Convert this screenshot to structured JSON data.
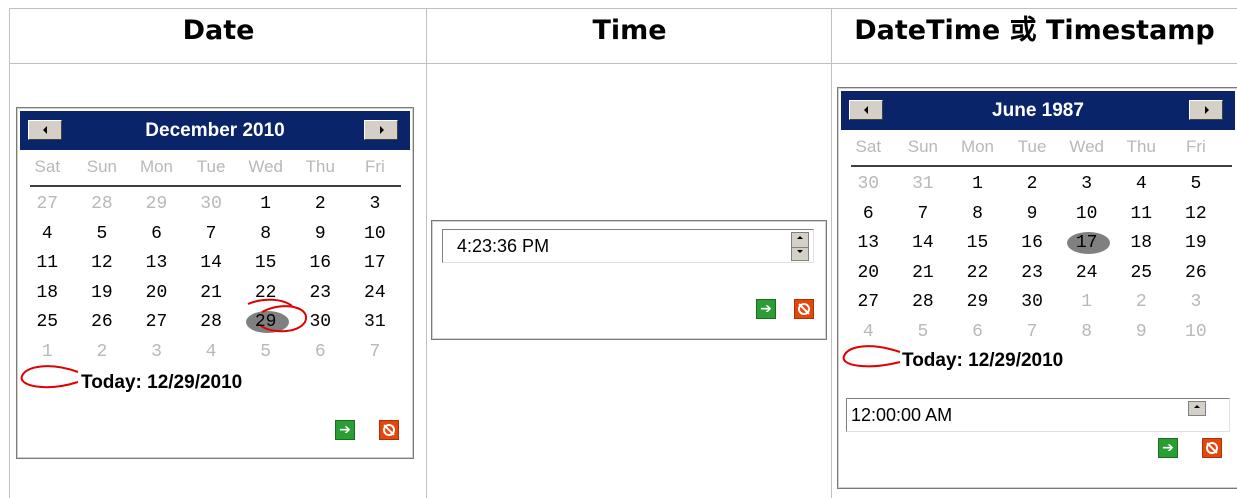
{
  "headers": {
    "date": "Date",
    "time": "Time",
    "datetime": "DateTime 或 Timestamp"
  },
  "date_picker": {
    "title": "December 2010",
    "weekdays": [
      "Sat",
      "Sun",
      "Mon",
      "Tue",
      "Wed",
      "Thu",
      "Fri"
    ],
    "weeks": [
      [
        "27",
        "28",
        "29",
        "30",
        "1",
        "2",
        "3"
      ],
      [
        "4",
        "5",
        "6",
        "7",
        "8",
        "9",
        "10"
      ],
      [
        "11",
        "12",
        "13",
        "14",
        "15",
        "16",
        "17"
      ],
      [
        "18",
        "19",
        "20",
        "21",
        "22",
        "23",
        "24"
      ],
      [
        "25",
        "26",
        "27",
        "28",
        "29",
        "30",
        "31"
      ],
      [
        "1",
        "2",
        "3",
        "4",
        "5",
        "6",
        "7"
      ]
    ],
    "selected": "29",
    "today_text": "Today: 12/29/2010"
  },
  "time_picker": {
    "value": "4:23:36 PM"
  },
  "datetime_picker": {
    "title": "June 1987",
    "weekdays": [
      "Sat",
      "Sun",
      "Mon",
      "Tue",
      "Wed",
      "Thu",
      "Fri"
    ],
    "weeks": [
      [
        "30",
        "31",
        "1",
        "2",
        "3",
        "4",
        "5"
      ],
      [
        "6",
        "7",
        "8",
        "9",
        "10",
        "11",
        "12"
      ],
      [
        "13",
        "14",
        "15",
        "16",
        "17",
        "18",
        "19"
      ],
      [
        "20",
        "21",
        "22",
        "23",
        "24",
        "25",
        "26"
      ],
      [
        "27",
        "28",
        "29",
        "30",
        "1",
        "2",
        "3"
      ],
      [
        "4",
        "5",
        "6",
        "7",
        "8",
        "9",
        "10"
      ]
    ],
    "selected": "17",
    "today_text": "Today: 12/29/2010",
    "time_value": "12:00:00 AM"
  },
  "colors": {
    "header_bar": "#0a246a",
    "ok_button": "#2a9d35",
    "cancel_button": "#e4470b",
    "annotation": "#e00000"
  },
  "icons": {
    "prev": "left-arrow-icon",
    "next": "right-arrow-icon",
    "ok": "green-arrow-icon",
    "cancel": "no-sign-icon"
  }
}
